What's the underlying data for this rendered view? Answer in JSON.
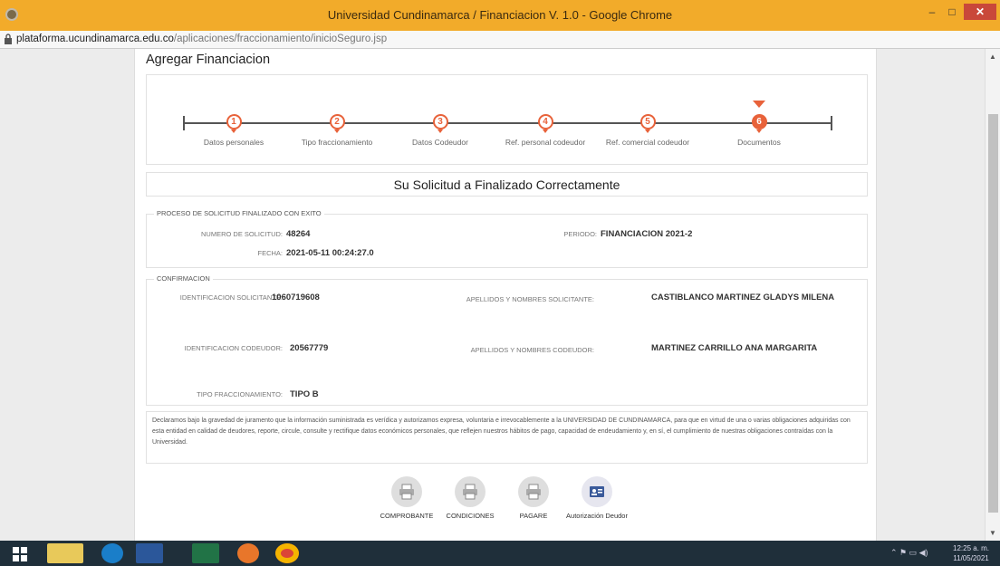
{
  "window": {
    "title": "Universidad Cundinamarca / Financiacion V. 1.0 - Google Chrome",
    "min_label": "–",
    "max_label": "□",
    "close_label": "✕"
  },
  "address": {
    "host": "plataforma.ucundinamarca.edu.co",
    "path": "/aplicaciones/fraccionamiento/inicioSeguro.jsp"
  },
  "page": {
    "title": "Agregar Financiacion",
    "steps": [
      {
        "number": "1",
        "label": "Datos personales"
      },
      {
        "number": "2",
        "label": "Tipo fraccionamiento"
      },
      {
        "number": "3",
        "label": "Datos Codeudor"
      },
      {
        "number": "4",
        "label": "Ref. personal codeudor"
      },
      {
        "number": "5",
        "label": "Ref. comercial codeudor"
      },
      {
        "number": "6",
        "label": "Documentos"
      }
    ],
    "active_step": 6,
    "success_message": "Su Solicitud a Finalizado Correctamente",
    "proceso": {
      "legend": "PROCESO DE SOLICITUD FINALIZADO CON EXITO",
      "numero_label": "NUMERO DE SOLICITUD:",
      "numero_value": "48264",
      "periodo_label": "PERIODO:",
      "periodo_value": "FINANCIACION 2021-2",
      "fecha_label": "FECHA:",
      "fecha_value": "2021-05-11 00:24:27.0"
    },
    "confirmacion": {
      "legend": "CONFIRMACION",
      "id_solicitante_label": "IDENTIFICACION SOLICITANTE:",
      "id_solicitante_value": "1060719608",
      "nombres_solicitante_label": "APELLIDOS Y NOMBRES SOLICITANTE:",
      "nombres_solicitante_value": "CASTIBLANCO MARTINEZ GLADYS MILENA",
      "id_codeudor_label": "IDENTIFICACION CODEUDOR:",
      "id_codeudor_value": "20567779",
      "nombres_codeudor_label": "APELLIDOS Y NOMBRES CODEUDOR:",
      "nombres_codeudor_value": "MARTINEZ CARRILLO ANA MARGARITA",
      "tipo_label": "TIPO FRACCIONAMIENTO:",
      "tipo_value": "TIPO B"
    },
    "declaration": "Declaramos bajo la gravedad de juramento que la información suministrada es verídica y autorizamos expresa, voluntaria e irrevocablemente a la UNIVERSIDAD DE CUNDINAMARCA, para que en virtud de una o varias obligaciones adquiridas con esta entidad en calidad de deudores, reporte, circule, consulte y rectifique datos económicos personales, que reflejen nuestros hábitos de pago, capacidad de endeudamiento y, en sí, el cumplimiento de nuestras obligaciones contraídas con la Universidad.",
    "actions": [
      {
        "label": "COMPROBANTE",
        "icon": "printer-icon"
      },
      {
        "label": "CONDICIONES",
        "icon": "printer-icon"
      },
      {
        "label": "PAGARE",
        "icon": "printer-icon"
      },
      {
        "label": "Autorización Deudor",
        "icon": "id-card-icon"
      }
    ]
  },
  "taskbar": {
    "time": "12:25 a. m.",
    "date": "11/05/2021",
    "apps": [
      "start-icon",
      "file-explorer-icon",
      "edge-icon",
      "word-icon",
      "excel-icon",
      "firefox-icon",
      "chrome-icon"
    ]
  }
}
